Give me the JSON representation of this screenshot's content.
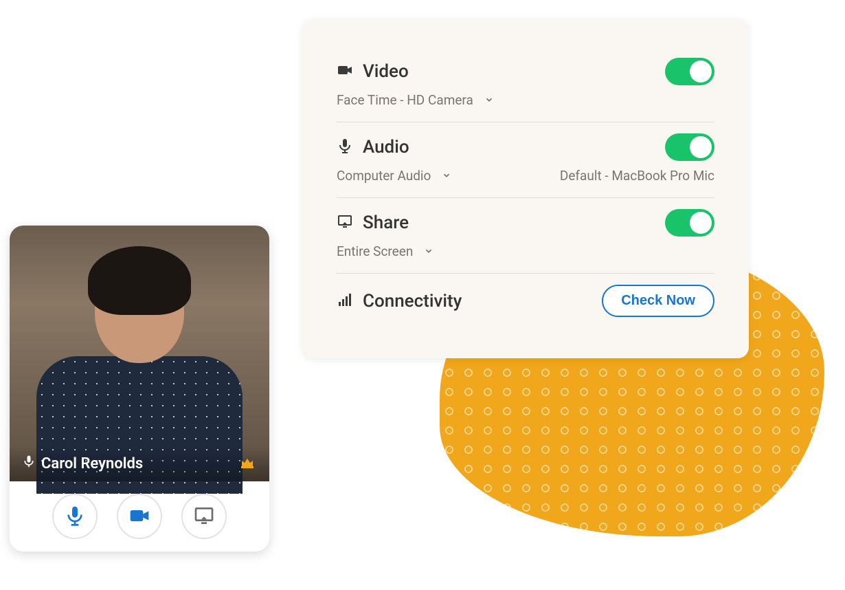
{
  "settings": {
    "video": {
      "label": "Video",
      "device": "Face Time - HD Camera",
      "enabled": true
    },
    "audio": {
      "label": "Audio",
      "device": "Computer Audio",
      "mic": "Default - MacBook Pro Mic",
      "enabled": true
    },
    "share": {
      "label": "Share",
      "target": "Entire Screen",
      "enabled": true
    },
    "connectivity": {
      "label": "Connectivity",
      "button": "Check Now"
    }
  },
  "tile": {
    "participant_name": "Carol Reynolds"
  },
  "colors": {
    "accent_orange": "#f0a71b",
    "toggle_green": "#18c36a",
    "link_blue": "#1876d2"
  }
}
